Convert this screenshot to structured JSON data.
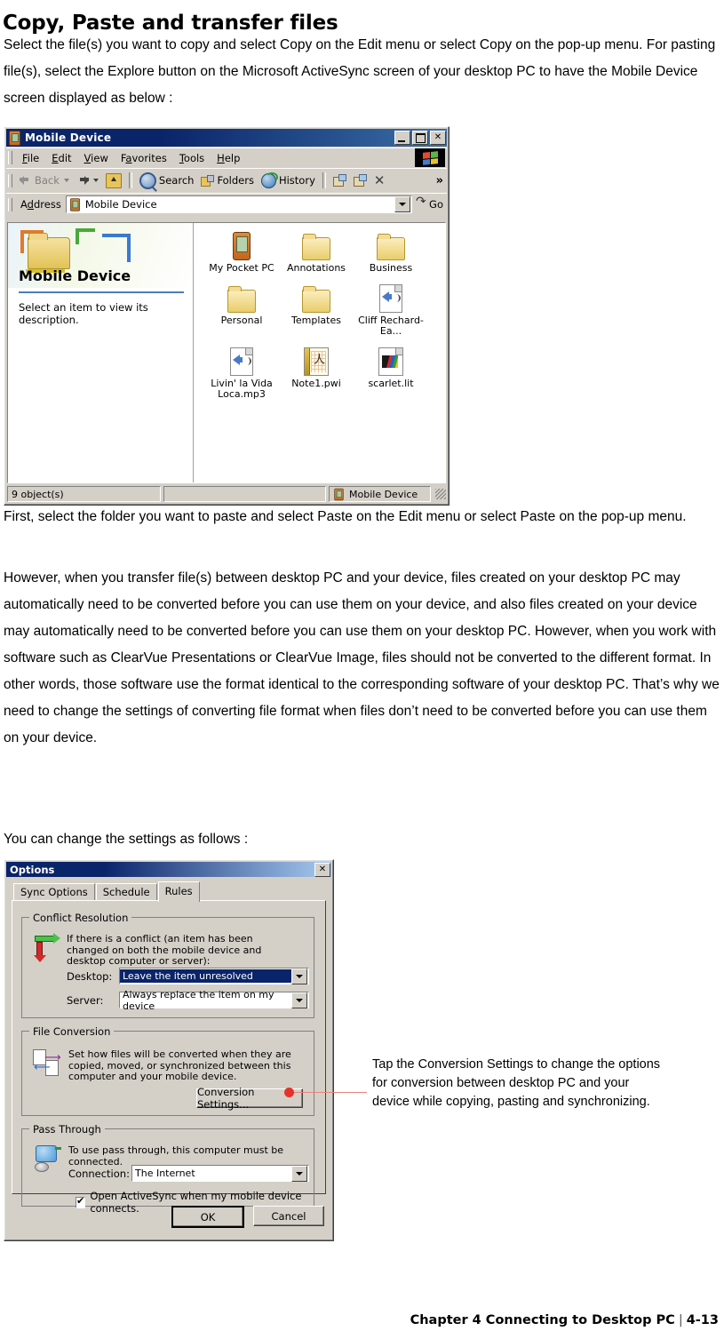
{
  "document": {
    "title": "Copy, Paste and transfer files",
    "intro": "Select the file(s) you want to copy and select Copy on the Edit menu or select Copy on the pop-up menu. For pasting file(s), select the Explore button on the Microsoft ActiveSync screen of your desktop PC to have the Mobile Device screen displayed as below :",
    "para2": "First, select the folder you want to paste and select Paste on the Edit menu or select Paste on the pop-up menu.",
    "para3": "However, when you transfer file(s) between desktop PC and your device, files created on your desktop PC may automatically need to be converted before you can use them on your device, and also files created on your device may automatically need to be converted before you can use them on your desktop PC. However, when you work with software such as ClearVue Presentations or ClearVue Image, files should not be converted to the different format. In other words, those software use the format identical to the corresponding software of your desktop PC. That’s why we need to change the settings of converting file format when files don’t need to be converted before you can use them on your device.",
    "para4": "You can change the settings as follows :",
    "footer_chapter": "Chapter 4 Connecting to Desktop PC",
    "footer_separator": "|",
    "footer_page": "4-13"
  },
  "callout": {
    "text": "Tap the Conversion Settings to change the options for conversion between desktop PC and your device while copying, pasting and synchronizing.",
    "line_color": "#e8837f",
    "dot_color": "#e8302a"
  },
  "mobile_window": {
    "title": "Mobile Device",
    "caption_buttons": [
      "minimize",
      "maximize",
      "close"
    ],
    "menus": [
      "File",
      "Edit",
      "View",
      "Favorites",
      "Tools",
      "Help"
    ],
    "toolbar": {
      "back": "Back",
      "forward": "",
      "up": "",
      "search": "Search",
      "folders": "Folders",
      "history": "History",
      "overflow": "»"
    },
    "address": {
      "label": "Address",
      "value": "Mobile Device",
      "go_label": "Go"
    },
    "webview": {
      "heading": "Mobile Device",
      "description": "Select an item to view its description."
    },
    "items": [
      {
        "label": "My Pocket PC",
        "icon": "pda-icon"
      },
      {
        "label": "Annotations",
        "icon": "folder-icon"
      },
      {
        "label": "Business",
        "icon": "folder-icon"
      },
      {
        "label": "Personal",
        "icon": "folder-icon"
      },
      {
        "label": "Templates",
        "icon": "folder-icon"
      },
      {
        "label": "Cliff Rechard-Ea...",
        "icon": "audio-file-icon"
      },
      {
        "label": "Livin' la Vida Loca.mp3",
        "icon": "audio-file-icon"
      },
      {
        "label": "Note1.pwi",
        "icon": "note-file-icon"
      },
      {
        "label": "scarlet.lit",
        "icon": "ebook-file-icon"
      }
    ],
    "statusbar": {
      "objects": "9 object(s)",
      "middle": "",
      "location": "Mobile Device"
    }
  },
  "options_dialog": {
    "title": "Options",
    "close_label": "✕",
    "tabs": [
      {
        "label": "Sync Options",
        "active": false
      },
      {
        "label": "Schedule",
        "active": false
      },
      {
        "label": "Rules",
        "active": true
      }
    ],
    "conflict_resolution": {
      "group_title": "Conflict Resolution",
      "description": "If there is a conflict (an item has been changed on both the mobile device and desktop computer or server):",
      "desktop_label": "Desktop:",
      "desktop_value": "Leave the item unresolved",
      "server_label": "Server:",
      "server_value": "Always replace the item on my device"
    },
    "file_conversion": {
      "group_title": "File Conversion",
      "description": "Set how files will be converted when they are copied, moved, or synchronized between this computer and your mobile device.",
      "button_label": "Conversion Settings..."
    },
    "pass_through": {
      "group_title": "Pass Through",
      "description": "To use pass through, this computer must be connected.",
      "connection_label": "Connection:",
      "connection_value": "The Internet",
      "checkbox_label": "Open ActiveSync when my mobile device connects.",
      "checkbox_checked": true
    },
    "buttons": {
      "ok": "OK",
      "cancel": "Cancel"
    }
  }
}
